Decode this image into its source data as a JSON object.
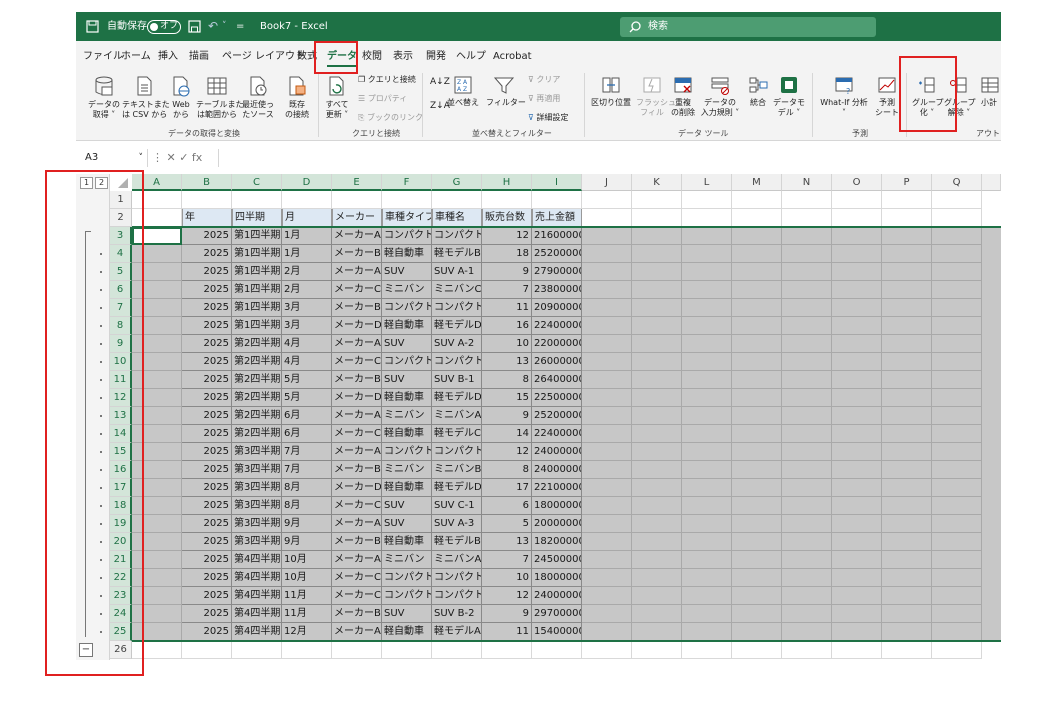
{
  "titlebar": {
    "autosave_label": "自動保存",
    "autosave_state": "オフ",
    "doc_title": "Book7 - Excel",
    "search_placeholder": "検索"
  },
  "tabs": [
    {
      "label": "ファイル"
    },
    {
      "label": "ホーム"
    },
    {
      "label": "挿入"
    },
    {
      "label": "描画"
    },
    {
      "label": "ページ レイアウト"
    },
    {
      "label": "数式"
    },
    {
      "label": "データ",
      "active": true
    },
    {
      "label": "校閲"
    },
    {
      "label": "表示"
    },
    {
      "label": "開発"
    },
    {
      "label": "ヘルプ"
    },
    {
      "label": "Acrobat"
    }
  ],
  "ribbon": {
    "get_data": {
      "line1": "データの",
      "line2": "取得 ˅"
    },
    "from_text": {
      "line1": "テキストまた",
      "line2": "は CSV から"
    },
    "from_web": {
      "line1": "Web",
      "line2": "から"
    },
    "from_table": {
      "line1": "テーブルまた",
      "line2": "は範囲から"
    },
    "recent": {
      "line1": "最近使っ",
      "line2": "たソース"
    },
    "existing": {
      "line1": "既存",
      "line2": "の接続"
    },
    "group_get_transform": "データの取得と変換",
    "refresh_all": {
      "line1": "すべて",
      "line2": "更新 ˅"
    },
    "queries_connections": "クエリと接続",
    "properties": "プロパティ",
    "edit_links": "ブックのリンク",
    "group_queries": "クエリと接続",
    "sort_btn": "並べ替え",
    "filter_btn": "フィルター",
    "clear": "クリア",
    "reapply": "再適用",
    "advanced": "詳細設定",
    "group_sort": "並べ替えとフィルター",
    "text_to_cols": "区切り位置",
    "flash_fill": {
      "line1": "フラッシュ",
      "line2": "フィル"
    },
    "remove_dup": {
      "line1": "重複",
      "line2": "の削除"
    },
    "validation": {
      "line1": "データの",
      "line2": "入力規則 ˅"
    },
    "consolidate": "統合",
    "data_model": {
      "line1": "データモ",
      "line2": "デル ˅"
    },
    "group_data_tools": "データ ツール",
    "whatif": {
      "line1": "What-If 分析",
      "line2": "˅"
    },
    "forecast": {
      "line1": "予測",
      "line2": "シート"
    },
    "group_forecast": "予測",
    "group_btn": {
      "line1": "グループ",
      "line2": "化 ˅"
    },
    "ungroup_btn": {
      "line1": "グループ",
      "line2": "解除 ˅"
    },
    "subtotal": "小計",
    "group_outline": "アウトラ"
  },
  "formula": {
    "namebox": "A3",
    "icons": "⋮  ✕  ✓  fx",
    "value": ""
  },
  "grid": {
    "level_buttons": [
      "1",
      "2"
    ],
    "columns": [
      "A",
      "B",
      "C",
      "D",
      "E",
      "F",
      "G",
      "H",
      "I",
      "J",
      "K",
      "L",
      "M",
      "N",
      "O",
      "P",
      "Q"
    ],
    "row_numbers": [
      "1",
      "2",
      "3",
      "4",
      "5",
      "6",
      "7",
      "8",
      "9",
      "10",
      "11",
      "12",
      "13",
      "14",
      "15",
      "16",
      "17",
      "18",
      "19",
      "20",
      "21",
      "22",
      "23",
      "24",
      "25",
      "26"
    ],
    "collapse_symbol": "−",
    "headers": [
      "年",
      "四半期",
      "月",
      "メーカー",
      "車種タイプ",
      "車種名",
      "販売台数",
      "売上金額"
    ],
    "rows": [
      [
        "2025",
        "第1四半期",
        "1月",
        "メーカーA",
        "コンパクト",
        "コンパクト",
        "12",
        "21600000"
      ],
      [
        "2025",
        "第1四半期",
        "1月",
        "メーカーB",
        "軽自動車",
        "軽モデルB",
        "18",
        "25200000"
      ],
      [
        "2025",
        "第1四半期",
        "2月",
        "メーカーA",
        "SUV",
        "SUV A-1",
        "9",
        "27900000"
      ],
      [
        "2025",
        "第1四半期",
        "2月",
        "メーカーC",
        "ミニバン",
        "ミニバンC",
        "7",
        "23800000"
      ],
      [
        "2025",
        "第1四半期",
        "3月",
        "メーカーB",
        "コンパクト",
        "コンパクト",
        "11",
        "20900000"
      ],
      [
        "2025",
        "第1四半期",
        "3月",
        "メーカーD",
        "軽自動車",
        "軽モデルD",
        "16",
        "22400000"
      ],
      [
        "2025",
        "第2四半期",
        "4月",
        "メーカーA",
        "SUV",
        "SUV A-2",
        "10",
        "22000000"
      ],
      [
        "2025",
        "第2四半期",
        "4月",
        "メーカーC",
        "コンパクト",
        "コンパクト",
        "13",
        "26000000"
      ],
      [
        "2025",
        "第2四半期",
        "5月",
        "メーカーB",
        "SUV",
        "SUV B-1",
        "8",
        "26400000"
      ],
      [
        "2025",
        "第2四半期",
        "5月",
        "メーカーD",
        "軽自動車",
        "軽モデルD",
        "15",
        "22500000"
      ],
      [
        "2025",
        "第2四半期",
        "6月",
        "メーカーA",
        "ミニバン",
        "ミニバンA",
        "9",
        "25200000"
      ],
      [
        "2025",
        "第2四半期",
        "6月",
        "メーカーC",
        "軽自動車",
        "軽モデルC",
        "14",
        "22400000"
      ],
      [
        "2025",
        "第3四半期",
        "7月",
        "メーカーA",
        "コンパクト",
        "コンパクト",
        "12",
        "24000000"
      ],
      [
        "2025",
        "第3四半期",
        "7月",
        "メーカーB",
        "ミニバン",
        "ミニバンB",
        "8",
        "24000000"
      ],
      [
        "2025",
        "第3四半期",
        "8月",
        "メーカーD",
        "軽自動車",
        "軽モデルD",
        "17",
        "22100000"
      ],
      [
        "2025",
        "第3四半期",
        "8月",
        "メーカーC",
        "SUV",
        "SUV C-1",
        "6",
        "18000000"
      ],
      [
        "2025",
        "第3四半期",
        "9月",
        "メーカーA",
        "SUV",
        "SUV A-3",
        "5",
        "20000000"
      ],
      [
        "2025",
        "第3四半期",
        "9月",
        "メーカーB",
        "軽自動車",
        "軽モデルB",
        "13",
        "18200000"
      ],
      [
        "2025",
        "第4四半期",
        "10月",
        "メーカーA",
        "ミニバン",
        "ミニバンA",
        "7",
        "24500000"
      ],
      [
        "2025",
        "第4四半期",
        "10月",
        "メーカーC",
        "コンパクト",
        "コンパクト",
        "10",
        "18000000"
      ],
      [
        "2025",
        "第4四半期",
        "11月",
        "メーカーC",
        "コンパクト",
        "コンパクト",
        "12",
        "24000000"
      ],
      [
        "2025",
        "第4四半期",
        "11月",
        "メーカーB",
        "SUV",
        "SUV B-2",
        "9",
        "29700000"
      ],
      [
        "2025",
        "第4四半期",
        "12月",
        "メーカーA",
        "軽自動車",
        "軽モデルA",
        "11",
        "15400000"
      ]
    ]
  },
  "colors": {
    "excel_green": "#1e7145",
    "annotation_red": "#e02020"
  }
}
